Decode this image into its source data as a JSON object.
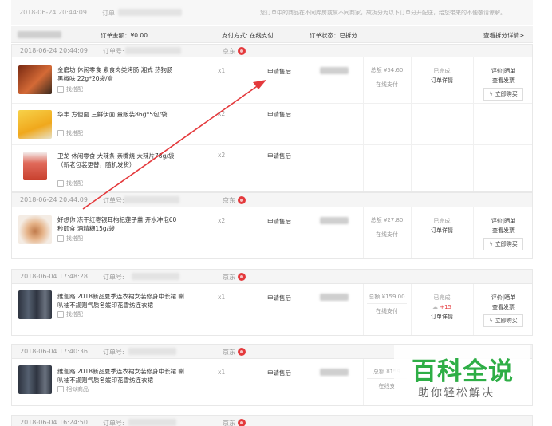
{
  "top_order": {
    "time": "2018-06-24 20:44:09",
    "order_label": "订单",
    "notice": "您订单中的商品在不同库房或属不同商家，故拆分为以下订单分开配送，给您带来的不便敬请谅解。"
  },
  "summary": {
    "amount": "订单金额：¥0.00",
    "payment": "支付方式: 在线支付",
    "status": "订单状态：已拆分",
    "details_link": "查看拆分详情>"
  },
  "orders": [
    {
      "time": "2018-06-24 20:44:09",
      "order_label": "订单号:",
      "shop": "京东",
      "amount": "总额 ¥54.60",
      "pay": "在线支付",
      "status": "已完成",
      "status_detail": "订单详情",
      "ops": [
        "评价|晒单",
        "查看发票"
      ],
      "buy_again": "立即购买",
      "items": [
        {
          "name": "金磨坊 休闲零食 素食肉类烤肠 湘式 热狗肠 黑椒味 22g*20袋/盒",
          "accessory": "找搭配",
          "qty": "x1",
          "after_sale": "申请售后",
          "thumb_color": "#b8502a"
        },
        {
          "name": "华丰 方便面 三鲜伊面 量贩装86g*5包/袋",
          "accessory": "找搭配",
          "qty": "x2",
          "after_sale": "申请售后",
          "thumb_color": "#f2c230"
        },
        {
          "name": "卫龙 休闲零食 大辣条 亲嘴烧 大辣片78g/袋（新老包装更替，随机发货）",
          "accessory": "找搭配",
          "qty": "x2",
          "after_sale": "申请售后",
          "thumb_color": "#d9534f"
        }
      ]
    },
    {
      "time": "2018-06-24 20:44:09",
      "order_label": "订单号:",
      "shop": "京东",
      "amount": "总额 ¥27.80",
      "pay": "在线支付",
      "status": "已完成",
      "status_detail": "订单详情",
      "ops": [
        "评价|晒单",
        "查看发票"
      ],
      "buy_again": "立即购买",
      "items": [
        {
          "name": "好想你 冻干红枣银耳枸杞莲子羹 开水冲泡60秒即食 酒精糊15g/袋",
          "accessory": "找搭配",
          "qty": "x2",
          "after_sale": "申请售后",
          "thumb_color": "#c98a5a"
        }
      ]
    },
    {
      "time": "2018-06-04 17:48:28",
      "order_label": "订单号:",
      "shop": "京东",
      "amount": "总额 ¥159.00",
      "pay": "在线支付",
      "status": "已完成",
      "points": "+15",
      "status_detail": "订单详情",
      "ops": [
        "评价|晒单",
        "查看发票"
      ],
      "buy_again": "立即购买",
      "items": [
        {
          "name": "维迦路 2018新品夏季连衣裙女装修身中长裙 喇叭袖不规则气质名媛印花雪纺连衣裙",
          "accessory": "找搭配",
          "qty": "x1",
          "after_sale": "申请售后",
          "thumb_color": "#333a44"
        }
      ]
    },
    {
      "time": "2018-06-04 17:40:36",
      "order_label": "订单号:",
      "shop": "京东",
      "amount": "总额 ¥159",
      "pay": "在线支",
      "items": [
        {
          "name": "维迦路 2018新品夏季连衣裙女装修身中长裙 喇叭袖不规则气质名媛印花雪纺连衣裙",
          "accessory": "相似商品",
          "qty": "x1",
          "after_sale": "申请售后",
          "thumb_color": "#333a44"
        }
      ]
    },
    {
      "time": "2018-06-04 16:24:50",
      "order_label": "订单号:",
      "shop": "京东"
    }
  ],
  "watermark": {
    "title": "百科全说",
    "subtitle": "助你轻松解决"
  },
  "colors": {
    "brand_red": "#e4393c",
    "watermark_green": "#2eae46",
    "points_red": "#e4393c"
  }
}
